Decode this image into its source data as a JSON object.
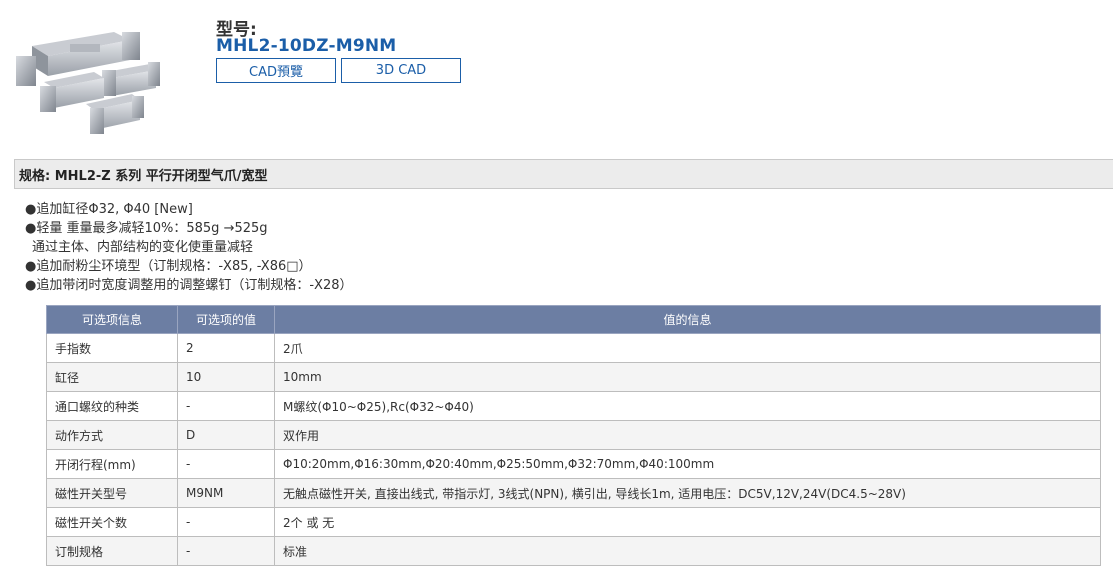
{
  "product": {
    "model_label": "型号:",
    "model_number": "MHL2-10DZ-M9NM",
    "buttons": {
      "cad_preview": "CAD預覽",
      "cad_3d": "3D CAD"
    }
  },
  "spec_header": "规格: MHL2-Z 系列 平行开闭型气爪/宽型",
  "features": [
    "●追加缸径Φ32, Φ40 [New]",
    "●轻量 重量最多减轻10%：585g →525g",
    "通过主体、内部结构的变化使重量减轻",
    "●追加耐粉尘环境型（订制规格：-X85, -X86□）",
    "●追加带闭时宽度调整用的调整螺钉（订制规格：-X28）"
  ],
  "table": {
    "headers": [
      "可选项信息",
      "可选项的值",
      "值的信息"
    ],
    "rows": [
      [
        "手指数",
        "2",
        "2爪"
      ],
      [
        "缸径",
        "10",
        "10mm"
      ],
      [
        "通口螺纹的种类",
        "-",
        "M螺纹(Φ10~Φ25),Rc(Φ32~Φ40)"
      ],
      [
        "动作方式",
        "D",
        "双作用"
      ],
      [
        "开闭行程(mm)",
        "-",
        "Φ10:20mm,Φ16:30mm,Φ20:40mm,Φ25:50mm,Φ32:70mm,Φ40:100mm"
      ],
      [
        "磁性开关型号",
        "M9NM",
        "无触点磁性开关, 直接出线式, 带指示灯, 3线式(NPN), 横引出, 导线长1m, 适用电压：DC5V,12V,24V(DC4.5~28V)"
      ],
      [
        "磁性开关个数",
        "-",
        "2个 或 无"
      ],
      [
        "订制规格",
        "-",
        "标准"
      ]
    ]
  }
}
